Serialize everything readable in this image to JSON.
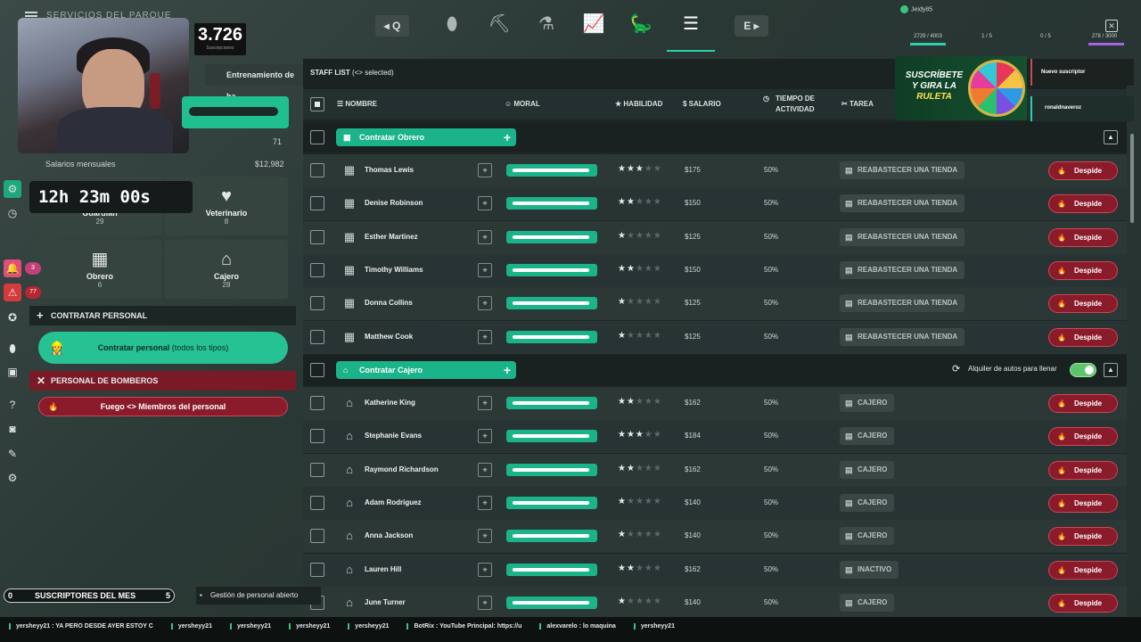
{
  "topbar": {
    "title": "SERVICIOS DEL PARQUE",
    "subscriber_count": "3.726",
    "subscriber_label": "Suscripciones",
    "nav_left": "Q",
    "nav_right": "E",
    "stats": [
      "2729 / 4003",
      "1 / 5",
      "0 / 5",
      "278 / 3000"
    ],
    "user": "Jeidy85"
  },
  "left_panel": {
    "tab_label": "Entrenamiento de ha",
    "count_row_value": "71",
    "salary_label": "Salarios mensuales",
    "salary_value": "$12,982",
    "timer": "12h 23m 00s",
    "cards": [
      {
        "name": "Guardián",
        "count": "29",
        "icon": "guard-icon"
      },
      {
        "name": "Veterinario",
        "count": "8",
        "icon": "heart-plus-icon"
      },
      {
        "name": "Obrero",
        "count": "6",
        "icon": "crates-icon"
      },
      {
        "name": "Cajero",
        "count": "28",
        "icon": "kiosk-icon"
      }
    ],
    "hire_section": "CONTRATAR PERSONAL",
    "hire_button": "Contratar personal",
    "hire_button_sub": "(todos los tipos)",
    "fire_section": "PERSONAL DE BOMBEROS",
    "fire_button": "Fuego <> Miembros del personal",
    "badges": [
      "3",
      "77"
    ]
  },
  "staff_list": {
    "title": "STAFF LIST",
    "title_sub": "(<> selected)",
    "columns": {
      "nombre": "NOMBRE",
      "moral": "MORAL",
      "habilidad": "HABILIDAD",
      "salario": "SALARIO",
      "tiempo_a": "TIEMPO DE",
      "tiempo_b": "ACTIVIDAD",
      "tarea": "TAREA"
    },
    "groups": [
      {
        "button": "Contratar Obrero",
        "icon": "crates-icon",
        "rows": [
          {
            "name": "Thomas Lewis",
            "moral": 0.86,
            "stars": 3,
            "salary": "$175",
            "activity": "50%",
            "task": "REABASTECER UNA TIENDA",
            "fire": "Despide"
          },
          {
            "name": "Denise Robinson",
            "moral": 0.86,
            "stars": 2,
            "salary": "$150",
            "activity": "50%",
            "task": "REABASTECER UNA TIENDA",
            "fire": "Despide"
          },
          {
            "name": "Esther Martinez",
            "moral": 0.86,
            "stars": 1,
            "salary": "$125",
            "activity": "50%",
            "task": "REABASTECER UNA TIENDA",
            "fire": "Despide"
          },
          {
            "name": "Timothy Williams",
            "moral": 0.86,
            "stars": 2,
            "salary": "$150",
            "activity": "50%",
            "task": "REABASTECER UNA TIENDA",
            "fire": "Despide"
          },
          {
            "name": "Donna Collins",
            "moral": 0.86,
            "stars": 1,
            "salary": "$125",
            "activity": "50%",
            "task": "REABASTECER UNA TIENDA",
            "fire": "Despide"
          },
          {
            "name": "Matthew Cook",
            "moral": 0.86,
            "stars": 1,
            "salary": "$125",
            "activity": "50%",
            "task": "REABASTECER UNA TIENDA",
            "fire": "Despide"
          }
        ]
      },
      {
        "button": "Contratar Cajero",
        "icon": "kiosk-icon",
        "autofill_label": "Alquiler de autos para llenar",
        "rows": [
          {
            "name": "Katherine King",
            "moral": 0.86,
            "stars": 2,
            "salary": "$162",
            "activity": "50%",
            "task": "CAJERO",
            "fire": "Despide"
          },
          {
            "name": "Stephanie Evans",
            "moral": 0.86,
            "stars": 3,
            "salary": "$184",
            "activity": "50%",
            "task": "CAJERO",
            "fire": "Despide"
          },
          {
            "name": "Raymond Richardson",
            "moral": 0.86,
            "stars": 2,
            "salary": "$162",
            "activity": "50%",
            "task": "CAJERO",
            "fire": "Despide"
          },
          {
            "name": "Adam Rodriguez",
            "moral": 0.86,
            "stars": 1,
            "salary": "$140",
            "activity": "50%",
            "task": "CAJERO",
            "fire": "Despide"
          },
          {
            "name": "Anna Jackson",
            "moral": 0.86,
            "stars": 1,
            "salary": "$140",
            "activity": "50%",
            "task": "CAJERO",
            "fire": "Despide"
          },
          {
            "name": "Lauren Hill",
            "moral": 0.86,
            "stars": 2,
            "salary": "$162",
            "activity": "50%",
            "task": "INACTIVO",
            "fire": "Despide"
          },
          {
            "name": "June Turner",
            "moral": 0.86,
            "stars": 1,
            "salary": "$140",
            "activity": "50%",
            "task": "CAJERO",
            "fire": "Despide"
          }
        ]
      }
    ]
  },
  "promo": {
    "line1": "SUSCRÍBETE",
    "line2": "Y GIRA LA",
    "line3": "RULETA"
  },
  "notifications": [
    "Nuevo suscriptor",
    "ronaldnaveroz"
  ],
  "bottom": {
    "subs_month_label": "SUSCRIPTORES DEL MES",
    "subs_month_left": "0",
    "subs_month_right": "5",
    "status": "Gestión de personal abierto"
  },
  "chat": [
    "yersheyy21 : YA PERO DESDE AYER ESTOY C",
    "yersheyy21",
    "yersheyy21",
    "yersheyy21",
    "yersheyy21",
    "BotRix : YouTube Principal: https://u",
    "alexvarelo : lo maquina",
    "yersheyy21"
  ]
}
